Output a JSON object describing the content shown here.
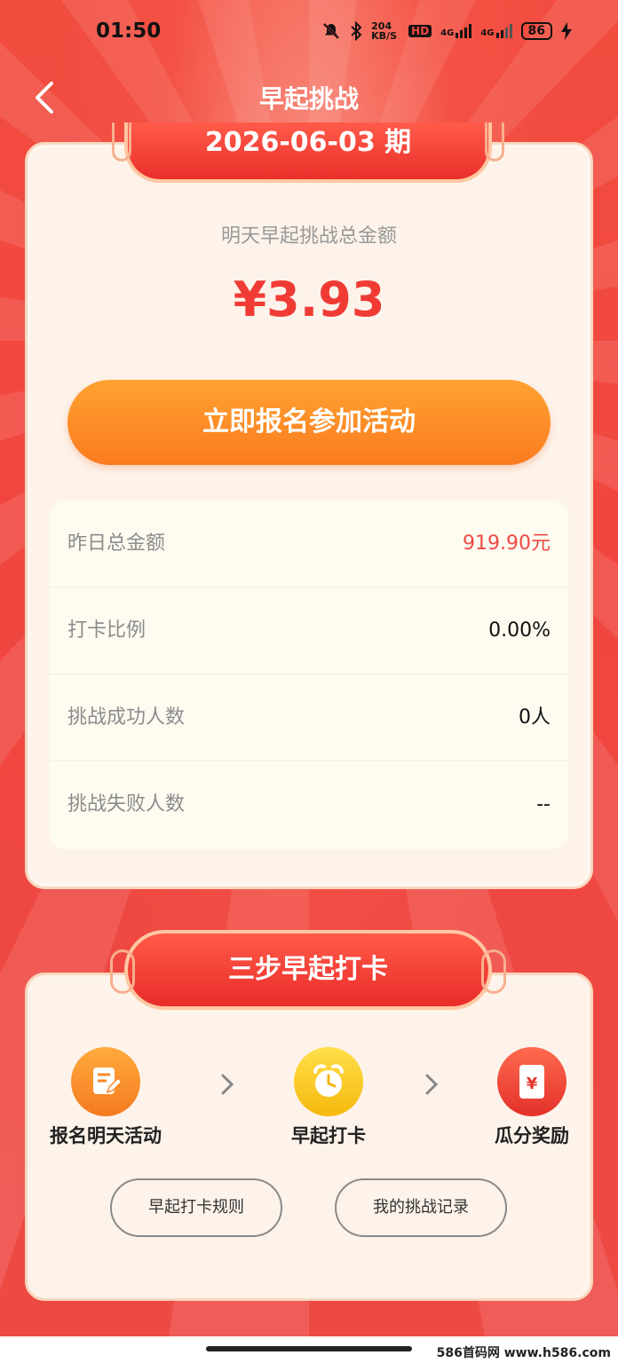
{
  "status_bar": {
    "time": "01:50",
    "net_speed": "204 KB/S",
    "hd": "HD",
    "net1": "4G",
    "net2": "4G",
    "battery": "86"
  },
  "nav": {
    "title": "早起挑战",
    "back_icon": "chevron-left-icon"
  },
  "card": {
    "period": "2026-06-03 期",
    "amount_label": "明天早起挑战总金额",
    "amount": "¥3.93",
    "join_button": "立即报名参加活动",
    "stats": [
      {
        "label": "昨日总金额",
        "value": "919.90元",
        "highlight": true
      },
      {
        "label": "打卡比例",
        "value": "0.00%",
        "highlight": false
      },
      {
        "label": "挑战成功人数",
        "value": "0人",
        "highlight": false
      },
      {
        "label": "挑战失败人数",
        "value": "--",
        "highlight": false
      }
    ]
  },
  "steps": {
    "title": "三步早起打卡",
    "items": [
      {
        "label": "报名明天活动",
        "icon": "edit-note-icon",
        "color": "#f98a2c"
      },
      {
        "label": "早起打卡",
        "icon": "alarm-clock-icon",
        "color": "#f9c81f"
      },
      {
        "label": "瓜分奖励",
        "icon": "red-envelope-icon",
        "color": "#ef4033"
      }
    ],
    "rules_button": "早起打卡规则",
    "records_button": "我的挑战记录"
  },
  "watermark": "586首码网 www.h586.com",
  "colors": {
    "primary_red": "#f03b35",
    "orange_button": "#fb7b1f",
    "card_bg": "#fdf3ea"
  }
}
